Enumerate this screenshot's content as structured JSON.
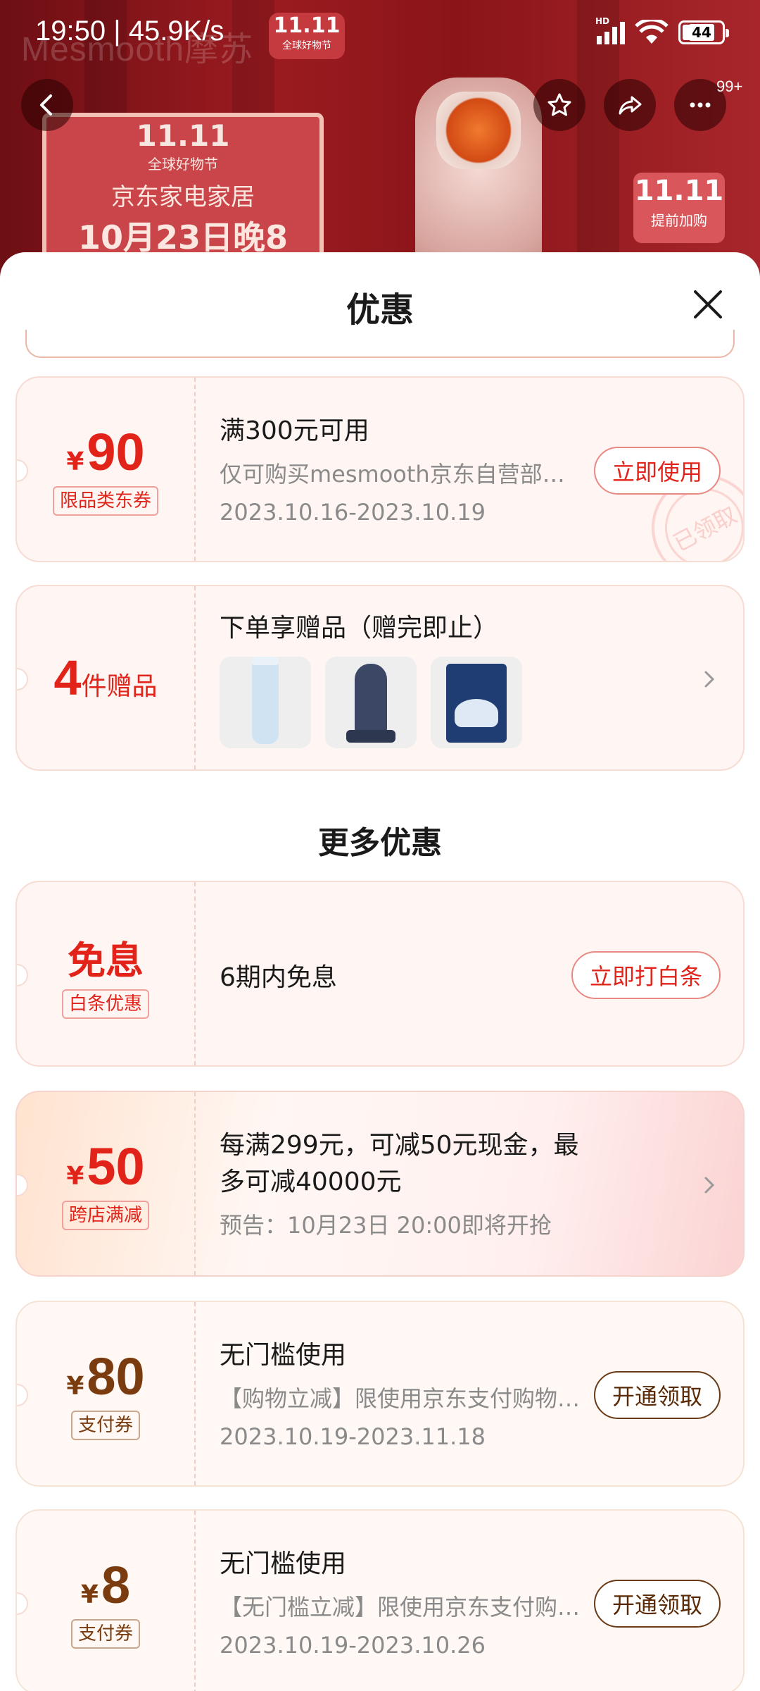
{
  "status_bar": {
    "time_speed": "19:50 | 45.9K/s",
    "network": "HD",
    "battery": "44"
  },
  "banner": {
    "brand_text": "Mesmooth摩苏",
    "event_logo": "11.11",
    "event_logo_sub": "全球好物节",
    "house_logo": "11.11",
    "house_sub": "全球好物节",
    "house_line1": "京东家电家居",
    "house_line2": "10月23日晚8",
    "preheat_logo": "11.11",
    "preheat_text": "提前加购"
  },
  "nav": {
    "more_badge": "99+"
  },
  "sheet": {
    "title": "优惠",
    "section_more": "更多优惠",
    "coupon_90": {
      "currency": "¥",
      "amount": "90",
      "tag": "限品类东券",
      "condition": "满300元可用",
      "scope": "仅可购买mesmooth京东自营部分商品",
      "validity": "2023.10.16-2023.10.19",
      "button": "立即使用",
      "stamp": "已领取"
    },
    "gift": {
      "count": "4",
      "unit": "件赠品",
      "title": "下单享赠品（赠完即止）",
      "items": [
        "洗面奶",
        "梳子",
        "面膜"
      ]
    },
    "interest_free": {
      "title": "免息",
      "tag": "白条优惠",
      "desc": "6期内免息",
      "button": "立即打白条"
    },
    "cross_store": {
      "currency": "¥",
      "amount": "50",
      "tag": "跨店满减",
      "desc_line1": "每满299元，可减50元现金，最",
      "desc_line2": "多可减40000元",
      "notice": "预告：10月23日 20:00即将开抢"
    },
    "pay_80": {
      "currency": "¥",
      "amount": "80",
      "tag": "支付券",
      "condition": "无门槛使用",
      "scope": "【购物立减】限使用京东支付购物时使用",
      "validity": "2023.10.19-2023.11.18",
      "button": "开通领取"
    },
    "pay_8": {
      "currency": "¥",
      "amount": "8",
      "tag": "支付券",
      "condition": "无门槛使用",
      "scope": "【无门槛立减】限使用京东支付购物时使用",
      "validity": "2023.10.19-2023.10.26",
      "button": "开通领取"
    }
  },
  "colors": {
    "accent_red": "#e2231a",
    "pay_brown": "#7a3b0e",
    "banner_red": "#9b1b20"
  },
  "icons": [
    "back-icon",
    "star-icon",
    "share-icon",
    "more-icon",
    "close-icon",
    "chevron-right-icon"
  ]
}
